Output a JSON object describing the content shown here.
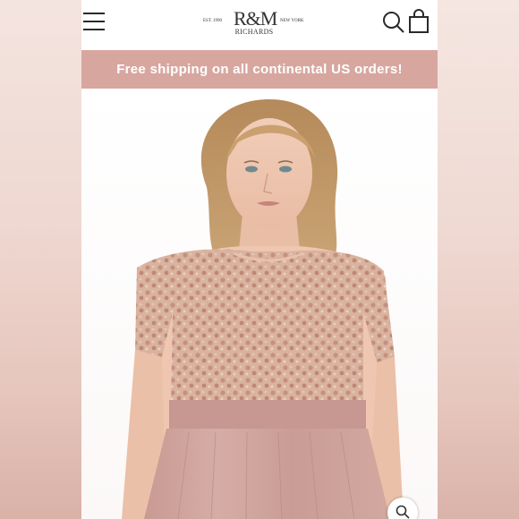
{
  "header": {
    "logo": {
      "mark": "R&M",
      "name": "RICHARDS",
      "est": "EST. 1990",
      "location": "NEW YORK"
    },
    "icons": {
      "menu": "hamburger-menu-icon",
      "search": "search-icon",
      "cart": "shopping-bag-icon",
      "zoom": "zoom-icon"
    }
  },
  "banner": {
    "text": "Free shipping on all continental US orders!",
    "background": "#d7a79f"
  },
  "colors": {
    "dress_top": "#d4ab9a",
    "dress_skirt": "#cfa39d",
    "banner": "#d7a79f"
  }
}
